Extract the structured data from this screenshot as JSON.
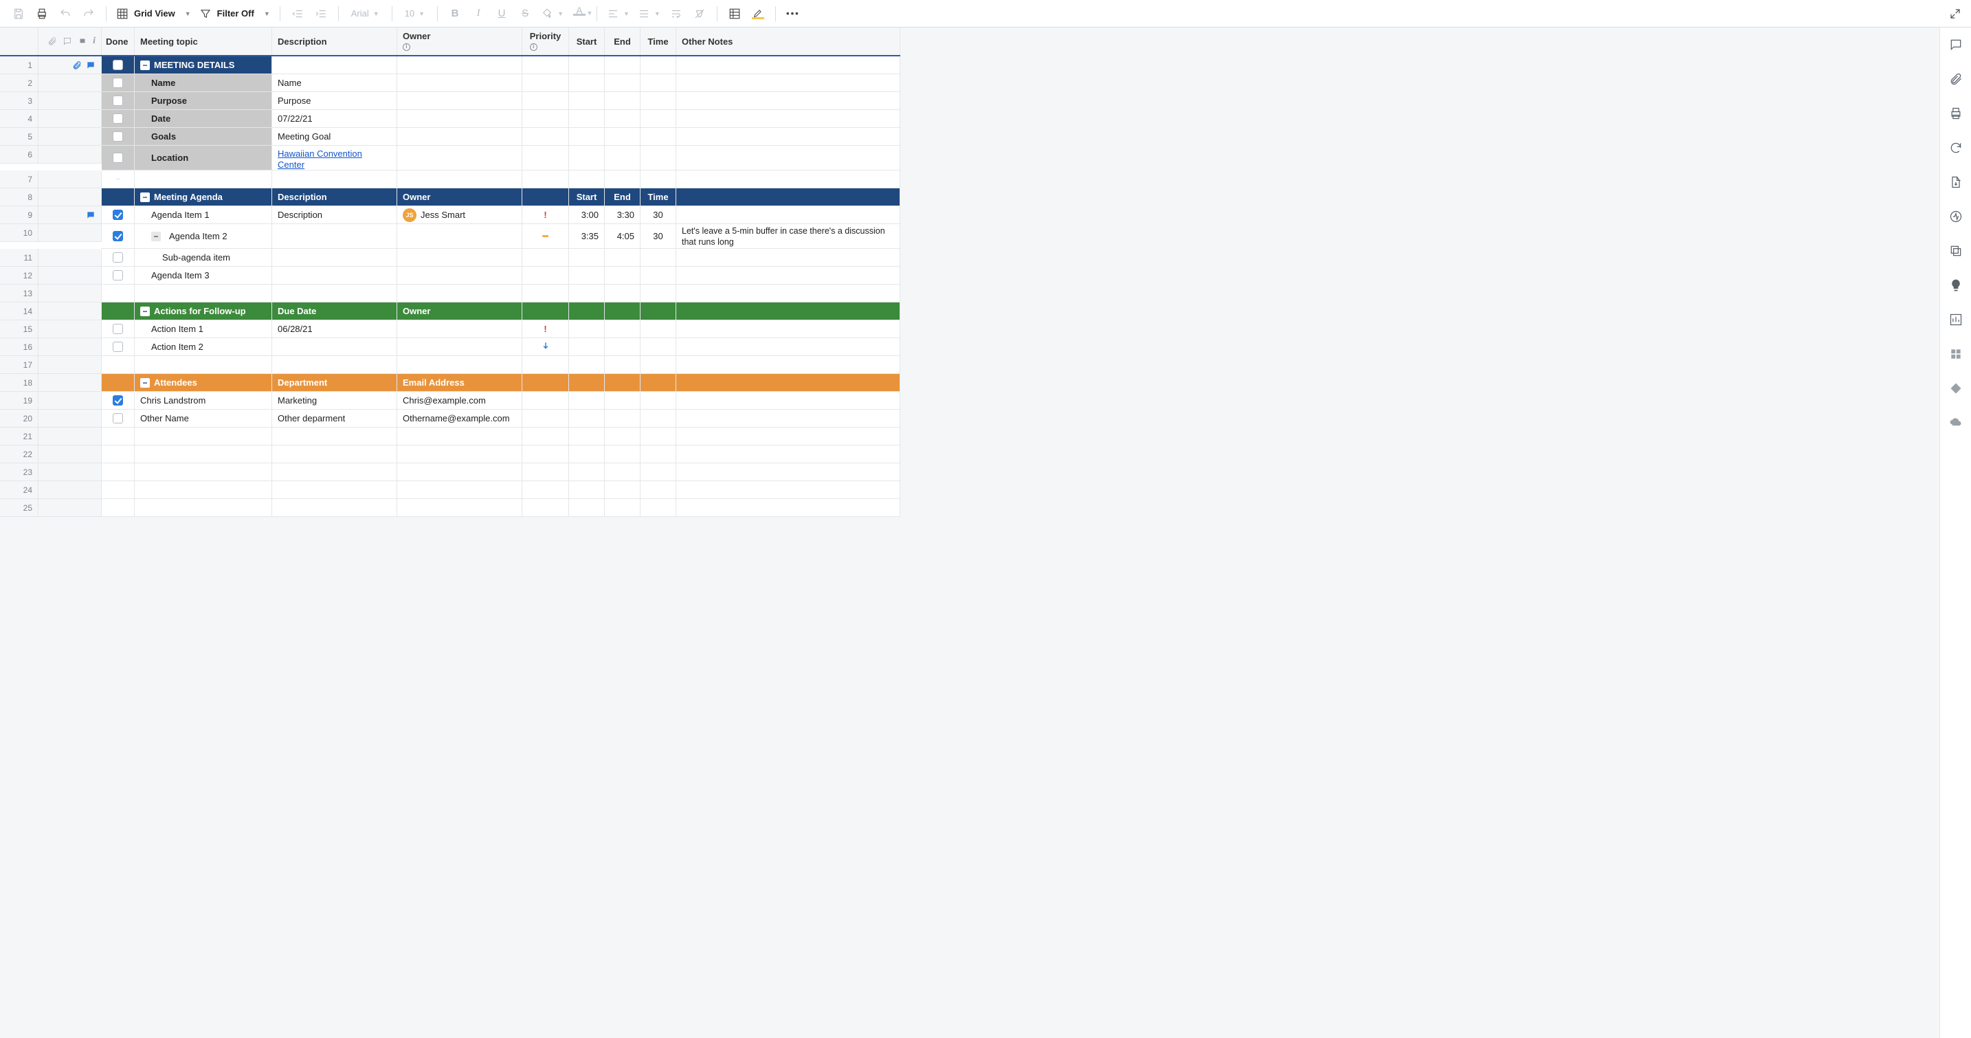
{
  "toolbar": {
    "view_label": "Grid View",
    "filter_label": "Filter Off",
    "font_name": "Arial",
    "font_size": "10"
  },
  "columns": {
    "done": "Done",
    "topic": "Meeting topic",
    "desc": "Description",
    "owner": "Owner",
    "priority": "Priority",
    "start": "Start",
    "end": "End",
    "time": "Time",
    "notes": "Other Notes"
  },
  "sections": {
    "meeting_details": {
      "title": "MEETING DETAILS",
      "rows": [
        {
          "num": "1"
        },
        {
          "num": "2",
          "label": "Name",
          "val": "Name"
        },
        {
          "num": "3",
          "label": "Purpose",
          "val": "Purpose"
        },
        {
          "num": "4",
          "label": "Date",
          "val": "07/22/21"
        },
        {
          "num": "5",
          "label": "Goals",
          "val": "Meeting Goal"
        },
        {
          "num": "6",
          "label": "Location",
          "val": "Hawaiian Convention Center",
          "link": true
        }
      ]
    },
    "agenda": {
      "num": "8",
      "title": "Meeting Agenda",
      "cols": {
        "desc": "Description",
        "owner": "Owner",
        "start": "Start",
        "end": "End",
        "time": "Time"
      },
      "rows": [
        {
          "num": "9",
          "checked": true,
          "comment": true,
          "topic": "Agenda Item 1",
          "desc": "Description",
          "owner_initials": "JS",
          "owner_name": "Jess Smart",
          "priority": "high",
          "start": "3:00",
          "end": "3:30",
          "time": "30"
        },
        {
          "num": "10",
          "checked": true,
          "handle": true,
          "topic": "Agenda Item 2",
          "priority": "med",
          "start": "3:35",
          "end": "4:05",
          "time": "30",
          "notes": "Let's leave a 5-min buffer in case there's a discussion that runs long"
        },
        {
          "num": "11",
          "topic": "Sub-agenda item",
          "indent": 2
        },
        {
          "num": "12",
          "topic": "Agenda Item 3",
          "indent": 1
        }
      ]
    },
    "actions": {
      "num": "14",
      "title": "Actions for Follow-up",
      "cols": {
        "desc": "Due Date",
        "owner": "Owner"
      },
      "rows": [
        {
          "num": "15",
          "topic": "Action Item 1",
          "desc": "06/28/21",
          "priority": "high"
        },
        {
          "num": "16",
          "topic": "Action Item 2",
          "priority": "low"
        }
      ]
    },
    "attendees": {
      "num": "18",
      "title": "Attendees",
      "cols": {
        "desc": "Department",
        "owner": "Email Address"
      },
      "rows": [
        {
          "num": "19",
          "checked": true,
          "topic": "Chris Landstrom",
          "desc": "Marketing",
          "owner": "Chris@example.com"
        },
        {
          "num": "20",
          "topic": "Other Name",
          "desc": "Other deparment",
          "owner": "Othername@example.com"
        }
      ]
    }
  },
  "blank_rows_before_agenda": {
    "num": "7"
  },
  "blank_rows_mid": {
    "num": "13"
  },
  "blank_rows_mid2": {
    "num": "17"
  },
  "trailing_rows": [
    "21",
    "22",
    "23",
    "24",
    "25"
  ]
}
